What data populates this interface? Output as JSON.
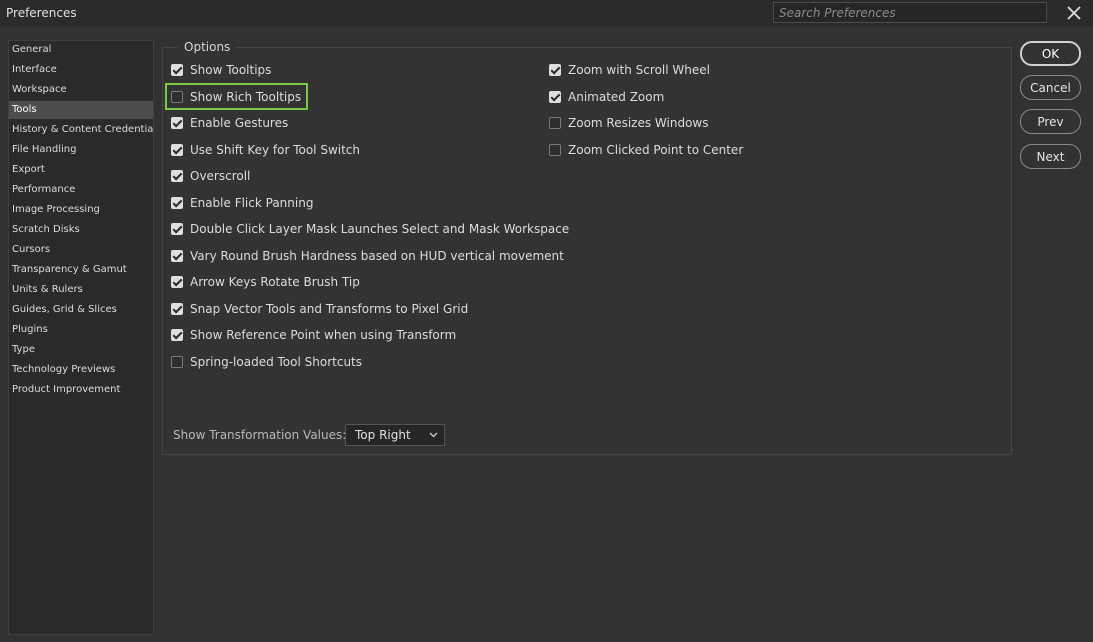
{
  "window": {
    "title": "Preferences"
  },
  "search": {
    "placeholder": "Search Preferences"
  },
  "sidebar": {
    "active": "Tools",
    "items": [
      "General",
      "Interface",
      "Workspace",
      "Tools",
      "History & Content Credentials",
      "File Handling",
      "Export",
      "Performance",
      "Image Processing",
      "Scratch Disks",
      "Cursors",
      "Transparency & Gamut",
      "Units & Rulers",
      "Guides, Grid & Slices",
      "Plugins",
      "Type",
      "Technology Previews",
      "Product Improvement"
    ]
  },
  "options": {
    "legend": "Options",
    "left": [
      {
        "label": "Show Tooltips",
        "checked": true
      },
      {
        "label": "Show Rich Tooltips",
        "checked": false
      },
      {
        "label": "Enable Gestures",
        "checked": true
      },
      {
        "label": "Use Shift Key for Tool Switch",
        "checked": true
      },
      {
        "label": "Overscroll",
        "checked": true
      },
      {
        "label": "Enable Flick Panning",
        "checked": true
      },
      {
        "label": "Double Click Layer Mask Launches Select and Mask Workspace",
        "checked": true
      },
      {
        "label": "Vary Round Brush Hardness based on HUD vertical movement",
        "checked": true
      },
      {
        "label": "Arrow Keys Rotate Brush Tip",
        "checked": true
      },
      {
        "label": "Snap Vector Tools and Transforms to Pixel Grid",
        "checked": true
      },
      {
        "label": "Show Reference Point when using Transform",
        "checked": true
      },
      {
        "label": "Spring-loaded Tool Shortcuts",
        "checked": false
      }
    ],
    "right": [
      {
        "label": "Zoom with Scroll Wheel",
        "checked": true
      },
      {
        "label": "Animated Zoom",
        "checked": true
      },
      {
        "label": "Zoom Resizes Windows",
        "checked": false
      },
      {
        "label": "Zoom Clicked Point to Center",
        "checked": false
      }
    ],
    "highlighted": "Show Rich Tooltips"
  },
  "transformation": {
    "label": "Show Transformation Values:",
    "value": "Top Right"
  },
  "buttons": {
    "ok": "OK",
    "cancel": "Cancel",
    "prev": "Prev",
    "next": "Next"
  },
  "colors": {
    "highlight": "#7ac943",
    "background": "#323232"
  },
  "icons": {
    "close": "close-icon",
    "dropdown": "chevron-down-icon",
    "check": "checkmark-icon"
  }
}
